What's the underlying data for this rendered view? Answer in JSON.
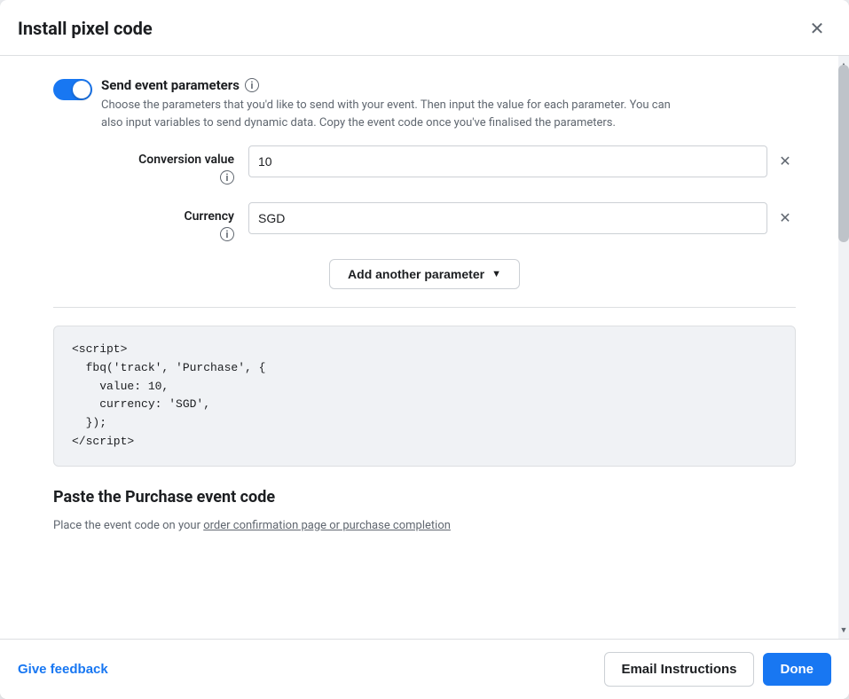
{
  "modal": {
    "title": "Install pixel code",
    "close_label": "×"
  },
  "toggle": {
    "title": "Send event parameters",
    "enabled": true,
    "description": "Choose the parameters that you'd like to send with your event. Then input the value for each parameter. You can also input variables to send dynamic data. Copy the event code once you've finalised the parameters."
  },
  "parameters": [
    {
      "label": "Conversion value",
      "value": "10",
      "placeholder": ""
    },
    {
      "label": "Currency",
      "value": "SGD",
      "placeholder": ""
    }
  ],
  "add_param_button": "Add another parameter",
  "code_block": "<script>\n  fbq('track', 'Purchase', {\n    value: 10,\n    currency: 'SGD',\n  });\n</script>",
  "paste_section": {
    "title": "Paste the Purchase event code",
    "description": "Place the event code on your order confirmation page or purchase completion"
  },
  "footer": {
    "feedback_label": "Give feedback",
    "email_instructions_label": "Email Instructions",
    "done_label": "Done"
  },
  "icons": {
    "info": "i",
    "close": "✕",
    "chevron_down": "▼",
    "clear": "✕",
    "scroll_up": "▲",
    "scroll_down": "▼"
  }
}
